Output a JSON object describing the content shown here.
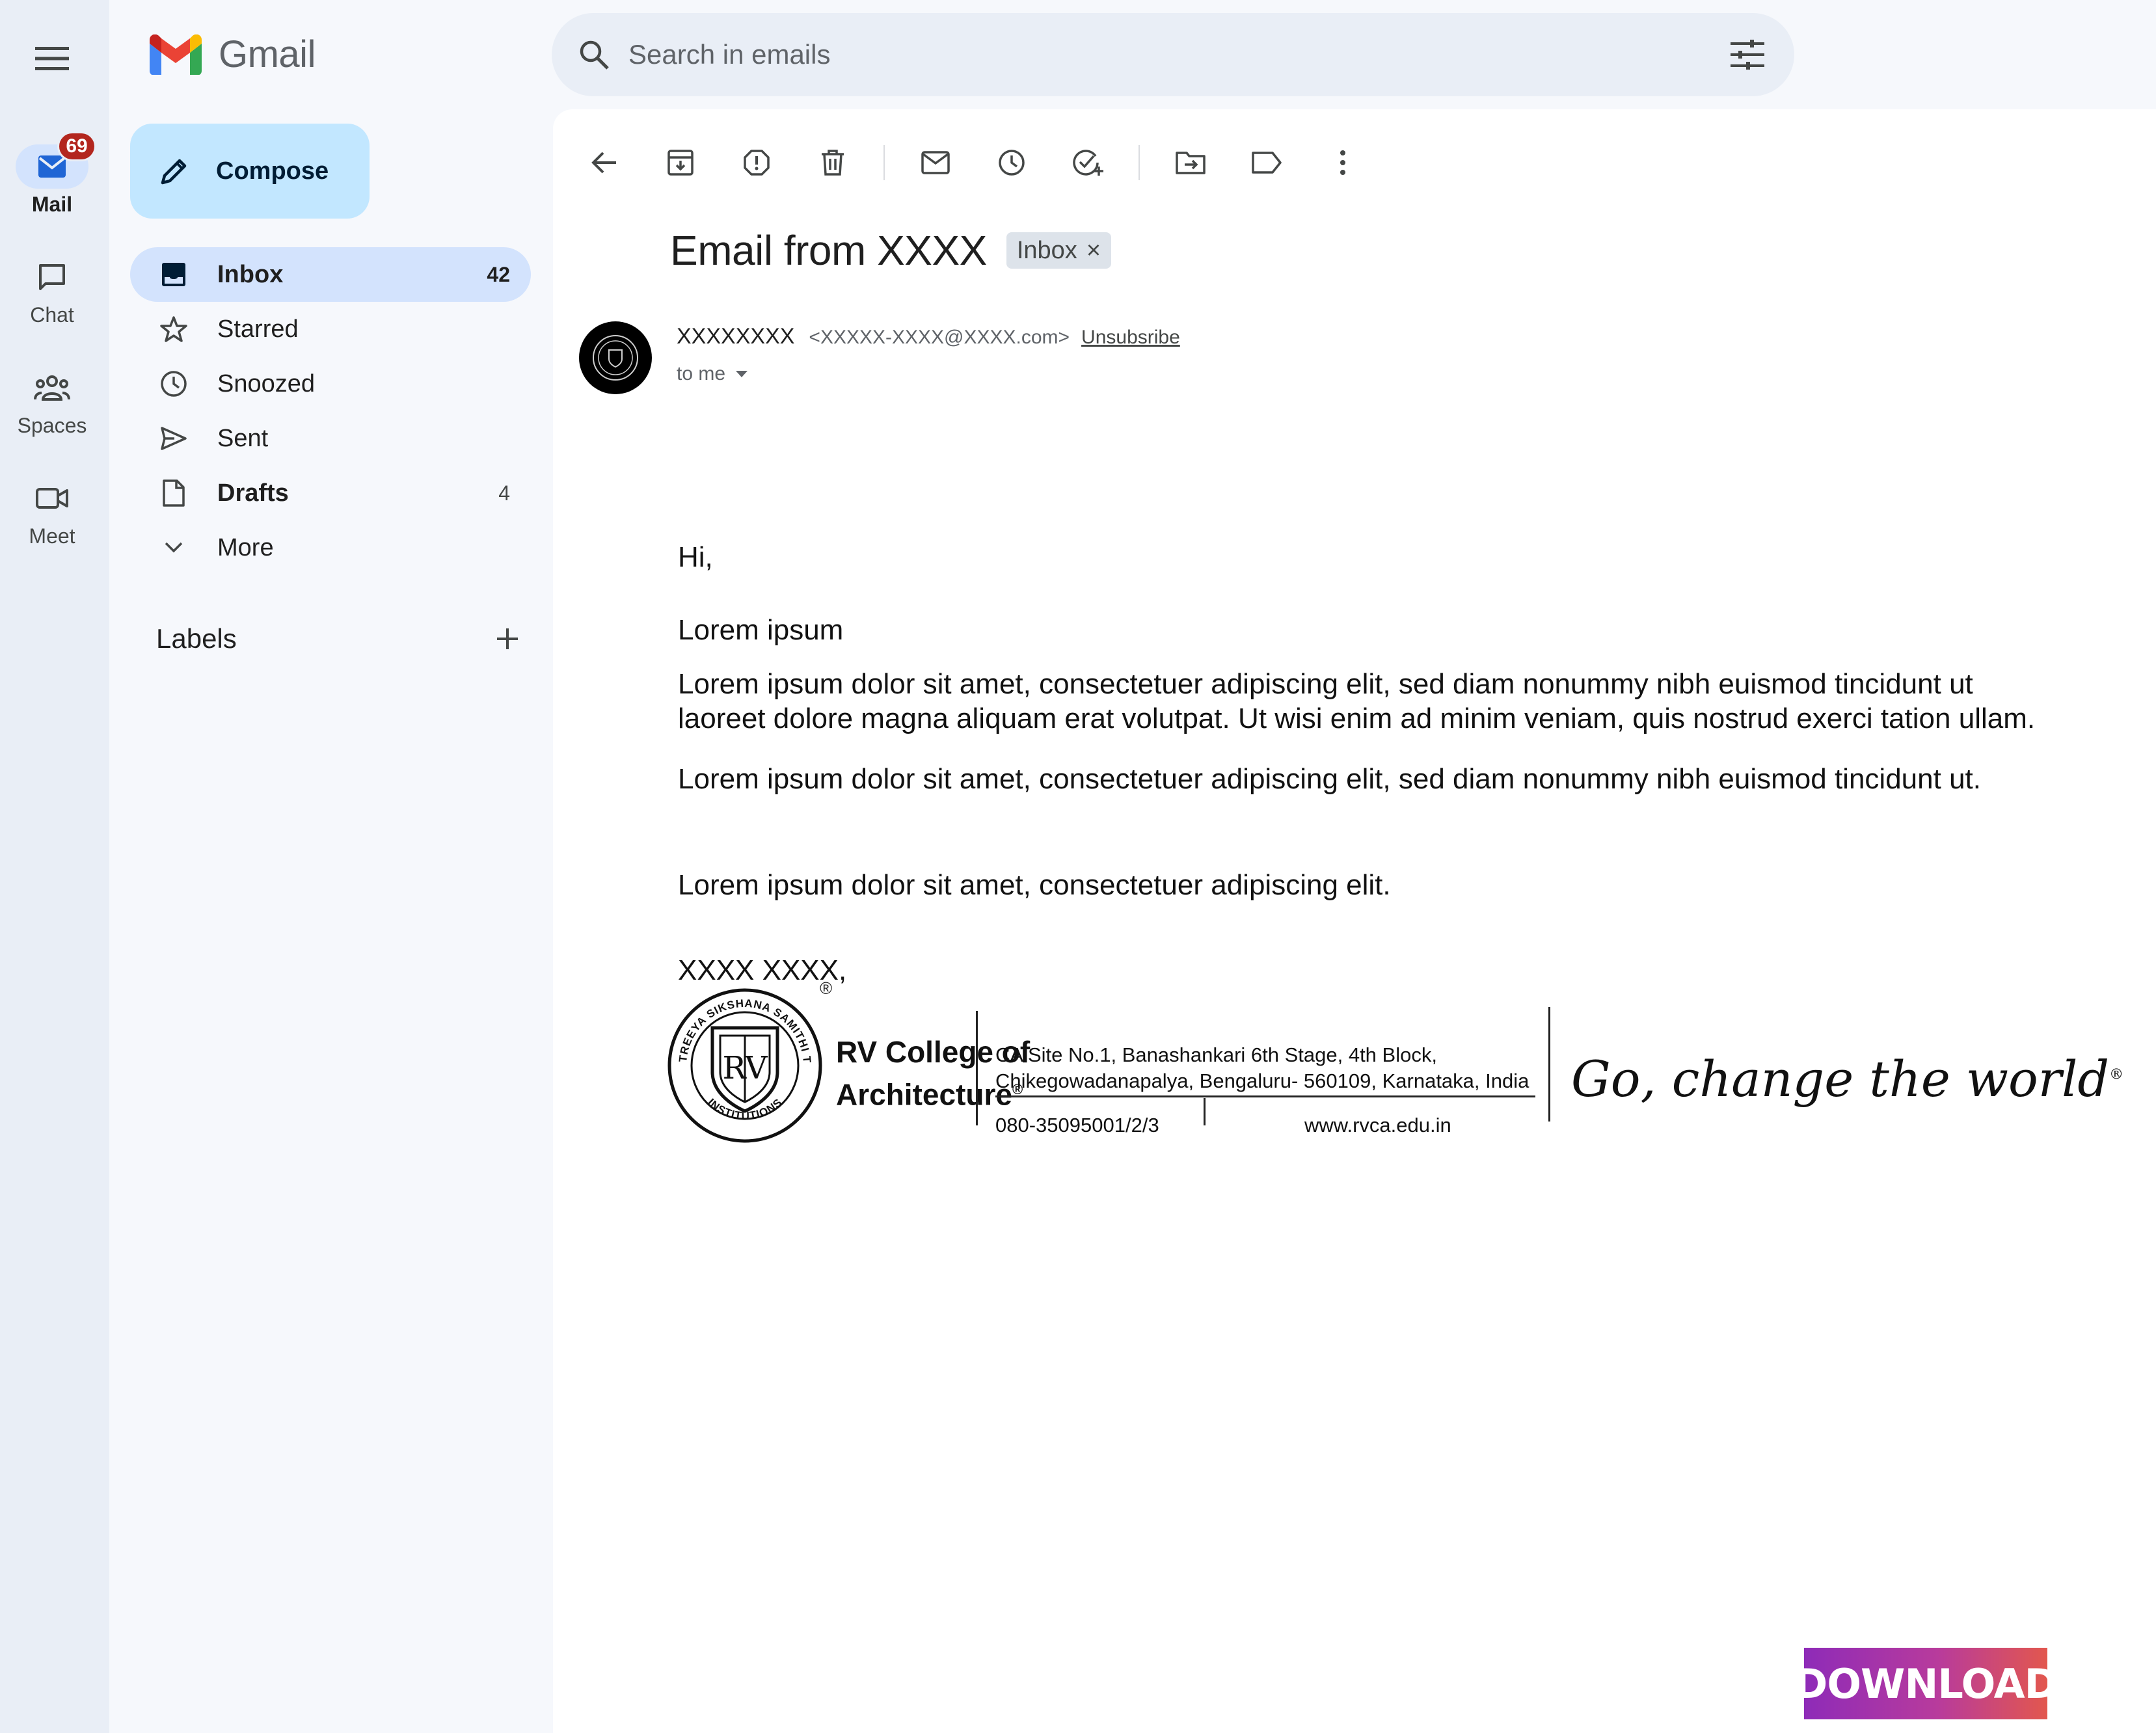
{
  "app": {
    "name": "Gmail"
  },
  "rail": {
    "items": [
      {
        "label": "Mail",
        "badge": "69"
      },
      {
        "label": "Chat"
      },
      {
        "label": "Spaces"
      },
      {
        "label": "Meet"
      }
    ]
  },
  "compose": {
    "label": "Compose"
  },
  "nav": {
    "items": [
      {
        "label": "Inbox",
        "count": "42",
        "icon": "inbox-icon"
      },
      {
        "label": "Starred",
        "count": "",
        "icon": "star-icon"
      },
      {
        "label": "Snoozed",
        "count": "",
        "icon": "clock-icon"
      },
      {
        "label": "Sent",
        "count": "",
        "icon": "send-icon"
      },
      {
        "label": "Drafts",
        "count": "4",
        "icon": "draft-icon"
      },
      {
        "label": "More",
        "count": "",
        "icon": "chevron-down-icon"
      }
    ]
  },
  "labels": {
    "title": "Labels"
  },
  "search": {
    "placeholder": "Search in emails"
  },
  "toolbar": {
    "icons": [
      "back-arrow-icon",
      "archive-icon",
      "report-spam-icon",
      "delete-icon",
      "mark-unread-icon",
      "snooze-icon",
      "add-task-icon",
      "move-to-icon",
      "label-icon",
      "more-vert-icon"
    ]
  },
  "email": {
    "subject": "Email from XXXX",
    "label_chip": "Inbox",
    "label_chip_remove": "×",
    "sender_name": "XXXXXXXX",
    "sender_email": "<XXXXX-XXXX@XXXX.com>",
    "unsubscribe": "Unsubsribe",
    "to": "to me",
    "greeting": "Hi,",
    "line1": "Lorem ipsum",
    "para1_line1": "Lorem ipsum dolor sit amet, consectetuer adipiscing elit, sed diam nonummy nibh euismod tincidunt ut",
    "para1_line2": "laoreet dolore magna aliquam erat volutpat. Ut wisi enim ad minim veniam, quis nostrud exerci tation ullam.",
    "para2": "Lorem ipsum dolor sit amet, consectetuer adipiscing elit, sed diam nonummy nibh euismod tincidunt ut.",
    "para3": "Lorem ipsum dolor sit amet, consectetuer adipiscing elit.",
    "signoff": "XXXX XXXX,",
    "sig_sep": "--"
  },
  "signature": {
    "college_line1": "RV College of",
    "college_line2": "Architecture",
    "reg_mark": "®",
    "address_line1": "CA Site No.1, Banashankari 6th Stage, 4th Block,",
    "address_line2": "Chikegowadanapalya, Bengaluru- 560109, Karnataka, India",
    "phone": "080-35095001/2/3",
    "website": "www.rvca.edu.in",
    "tagline": "Go, change the world",
    "logo_top_text": "RASHTREEYA SIKSHANA SAMITHI TRUST",
    "logo_bottom_text": "INSTITUTIONS",
    "logo_monogram": "RV"
  },
  "download": {
    "label": "DOWNLOAD"
  },
  "colors": {
    "rail_bg": "#e9eef6",
    "active_nav": "#d3e3fd",
    "compose_bg": "#c2e7ff",
    "badge": "#b3261e",
    "gmail_red": "#ea4335",
    "gmail_blue": "#4285f4",
    "gmail_green": "#34a853",
    "gmail_yellow": "#fbbc04"
  }
}
